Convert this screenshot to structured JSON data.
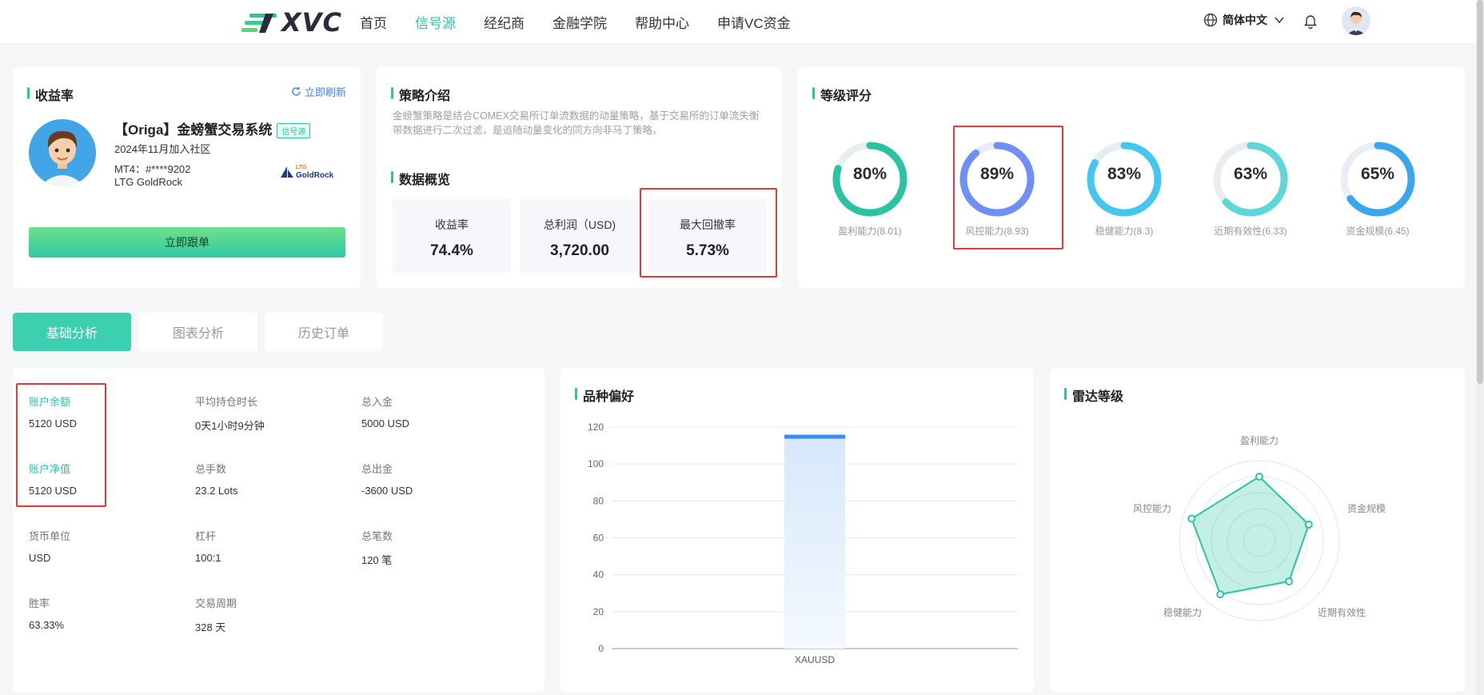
{
  "header": {
    "logo_text": "XVC",
    "nav": [
      "首页",
      "信号源",
      "经纪商",
      "金融学院",
      "帮助中心",
      "申请VC资金"
    ],
    "active_index": 1,
    "language": "简体中文"
  },
  "profile": {
    "title": "收益率",
    "refresh_label": "立即刷新",
    "name": "【Origa】金螃蟹交易系统",
    "badge": "信号源",
    "joined": "2024年11月加入社区",
    "mt4": "MT4：#****9202",
    "broker": "LTG GoldRock",
    "broker_logo_top": "LTG",
    "broker_logo_bottom": "GoldRock",
    "follow_button": "立即跟单"
  },
  "strategy": {
    "title": "策略介绍",
    "description": "金螃蟹策略是结合COMEX交易所订单流数据的动量策略，基于交易所的订单流失衡带数据进行二次过滤，是追随动量变化的同方向非马丁策略。",
    "overview_title": "数据概览",
    "stats": [
      {
        "label": "收益率",
        "value": "74.4%"
      },
      {
        "label": "总利润（USD)",
        "value": "3,720.00"
      },
      {
        "label": "最大回撤率",
        "value": "5.73%"
      }
    ]
  },
  "rating": {
    "title": "等级评分",
    "gauges": [
      {
        "value": "80%",
        "percent": 80,
        "label": "盈利能力(8.01)",
        "color": "#2bc4a2",
        "track": "#e6f0ee"
      },
      {
        "value": "89%",
        "percent": 89,
        "label": "风控能力(8.93)",
        "color": "#6f8ff5",
        "track": "#e9ecf6"
      },
      {
        "value": "83%",
        "percent": 83,
        "label": "稳健能力(8.3)",
        "color": "#45c6ef",
        "track": "#e7eef3"
      },
      {
        "value": "63%",
        "percent": 63,
        "label": "近期有效性(6.33)",
        "color": "#5fd6d8",
        "track": "#e8eef0"
      },
      {
        "value": "65%",
        "percent": 65,
        "label": "资金规模(6.45)",
        "color": "#3aa6ee",
        "track": "#e8eef3"
      }
    ]
  },
  "tabs": [
    "基础分析",
    "图表分析",
    "历史订单"
  ],
  "account": {
    "items": [
      {
        "label": "账户余额",
        "value": "5120 USD"
      },
      {
        "label": "平均持仓时长",
        "value": "0天1小时9分钟"
      },
      {
        "label": "总入金",
        "value": "5000 USD"
      },
      {
        "label": "账户净值",
        "value": "5120 USD"
      },
      {
        "label": "总手数",
        "value": "23.2 Lots"
      },
      {
        "label": "总出金",
        "value": "-3600 USD"
      },
      {
        "label": "货币单位",
        "value": "USD"
      },
      {
        "label": "杠杆",
        "value": "100:1"
      },
      {
        "label": "总笔数",
        "value": "120 笔"
      },
      {
        "label": "胜率",
        "value": "63.33%"
      },
      {
        "label": "交易周期",
        "value": "328 天"
      }
    ]
  },
  "preference": {
    "title": "品种偏好",
    "chart_data": {
      "type": "bar",
      "categories": [
        "XAUUSD"
      ],
      "values": [
        115
      ],
      "yticks": [
        "0",
        "20",
        "40",
        "60",
        "80",
        "100",
        "120"
      ],
      "ylim": [
        0,
        120
      ],
      "color": "#3b8cf0"
    }
  },
  "radar": {
    "title": "雷达等级",
    "chart_data": {
      "type": "radar",
      "axes": [
        "盈利能力",
        "资金规模",
        "近期有效性",
        "稳健能力",
        "风控能力"
      ],
      "values": [
        80,
        65,
        63,
        83,
        89
      ],
      "max": 100,
      "color": "#2bc4a2"
    }
  }
}
